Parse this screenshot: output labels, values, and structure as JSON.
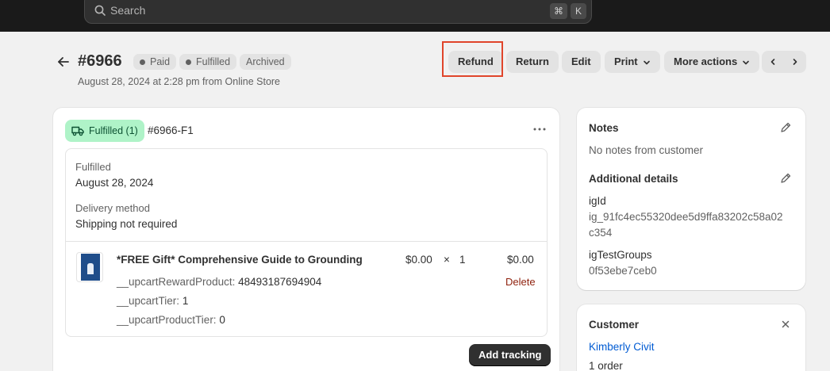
{
  "search": {
    "placeholder": "Search",
    "kbd1": "⌘",
    "kbd2": "K"
  },
  "order": {
    "number": "#6966",
    "badges": [
      "Paid",
      "Fulfilled",
      "Archived"
    ],
    "subtitle": "August 28, 2024 at 2:28 pm from Online Store"
  },
  "actions": {
    "refund": "Refund",
    "return": "Return",
    "edit": "Edit",
    "print": "Print",
    "more": "More actions"
  },
  "fulfillment": {
    "badge": "Fulfilled (1)",
    "id": "#6966-F1",
    "status_label": "Fulfilled",
    "status_date": "August 28, 2024",
    "delivery_label": "Delivery method",
    "delivery_value": "Shipping not required",
    "item": {
      "title": "*FREE Gift* Comprehensive Guide to Grounding",
      "props": [
        {
          "key": "__upcartRewardProduct:",
          "value": "48493187694904"
        },
        {
          "key": "__upcartTier:",
          "value": "1"
        },
        {
          "key": "__upcartProductTier:",
          "value": "0"
        }
      ],
      "unit_price": "$0.00",
      "times": "×",
      "qty": "1",
      "total": "$0.00",
      "delete": "Delete"
    },
    "add_tracking": "Add tracking"
  },
  "notes": {
    "title": "Notes",
    "text": "No notes from customer",
    "additional_title": "Additional details",
    "fields": [
      {
        "key": "igId",
        "value_line1": "ig_91fc4ec55320dee5d9ffa83202c58a02",
        "value_line2": "c354"
      },
      {
        "key": "igTestGroups",
        "value_line1": "0f53ebe7ceb0"
      }
    ]
  },
  "customer": {
    "title": "Customer",
    "name": "Kimberly Civit",
    "orders": "1 order"
  },
  "colors": {
    "topbar": "#1a1a1a",
    "success_bg": "#aff3c8",
    "link": "#005bd3",
    "critical": "#8e1f0b",
    "highlight": "#e0452b"
  }
}
